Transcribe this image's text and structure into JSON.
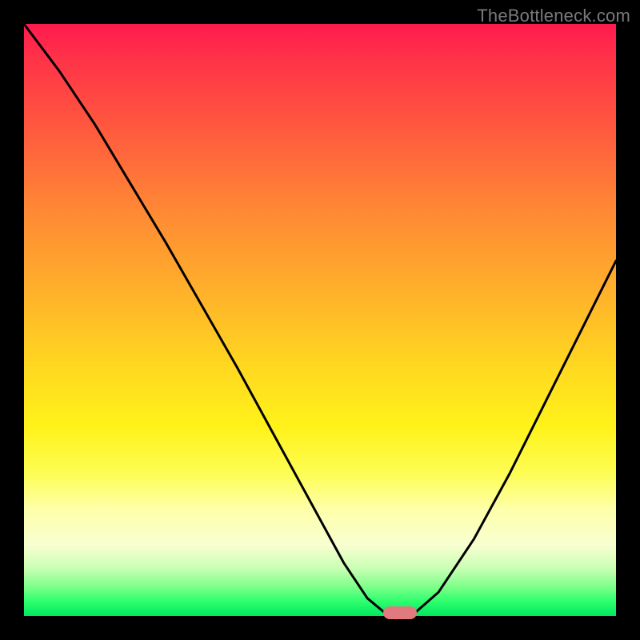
{
  "watermark": "TheBottleneck.com",
  "colors": {
    "frame": "#000000",
    "curve_stroke": "#000000",
    "marker": "#e17a7f"
  },
  "chart_data": {
    "type": "line",
    "title": "",
    "xlabel": "",
    "ylabel": "",
    "xlim": [
      0,
      100
    ],
    "ylim": [
      0,
      100
    ],
    "grid": false,
    "legend": false,
    "series": [
      {
        "name": "bottleneck-curve",
        "x": [
          0,
          6,
          12,
          18,
          24,
          30,
          36,
          42,
          48,
          54,
          58,
          61,
          63.5,
          66,
          70,
          76,
          82,
          88,
          94,
          100
        ],
        "values": [
          100,
          92,
          83,
          73,
          63,
          52.5,
          42,
          31,
          20,
          9,
          3,
          0.5,
          0,
          0.5,
          4,
          13,
          24,
          36,
          48,
          60
        ]
      }
    ],
    "annotations": [
      {
        "name": "optimum-marker",
        "x": 63.5,
        "y": 0.6
      }
    ],
    "gradient_stops": [
      {
        "pos": 0,
        "color": "#ff1a4d"
      },
      {
        "pos": 0.46,
        "color": "#ffb32a"
      },
      {
        "pos": 0.76,
        "color": "#fdfd55"
      },
      {
        "pos": 0.95,
        "color": "#7fff8a"
      },
      {
        "pos": 1.0,
        "color": "#00e860"
      }
    ]
  }
}
